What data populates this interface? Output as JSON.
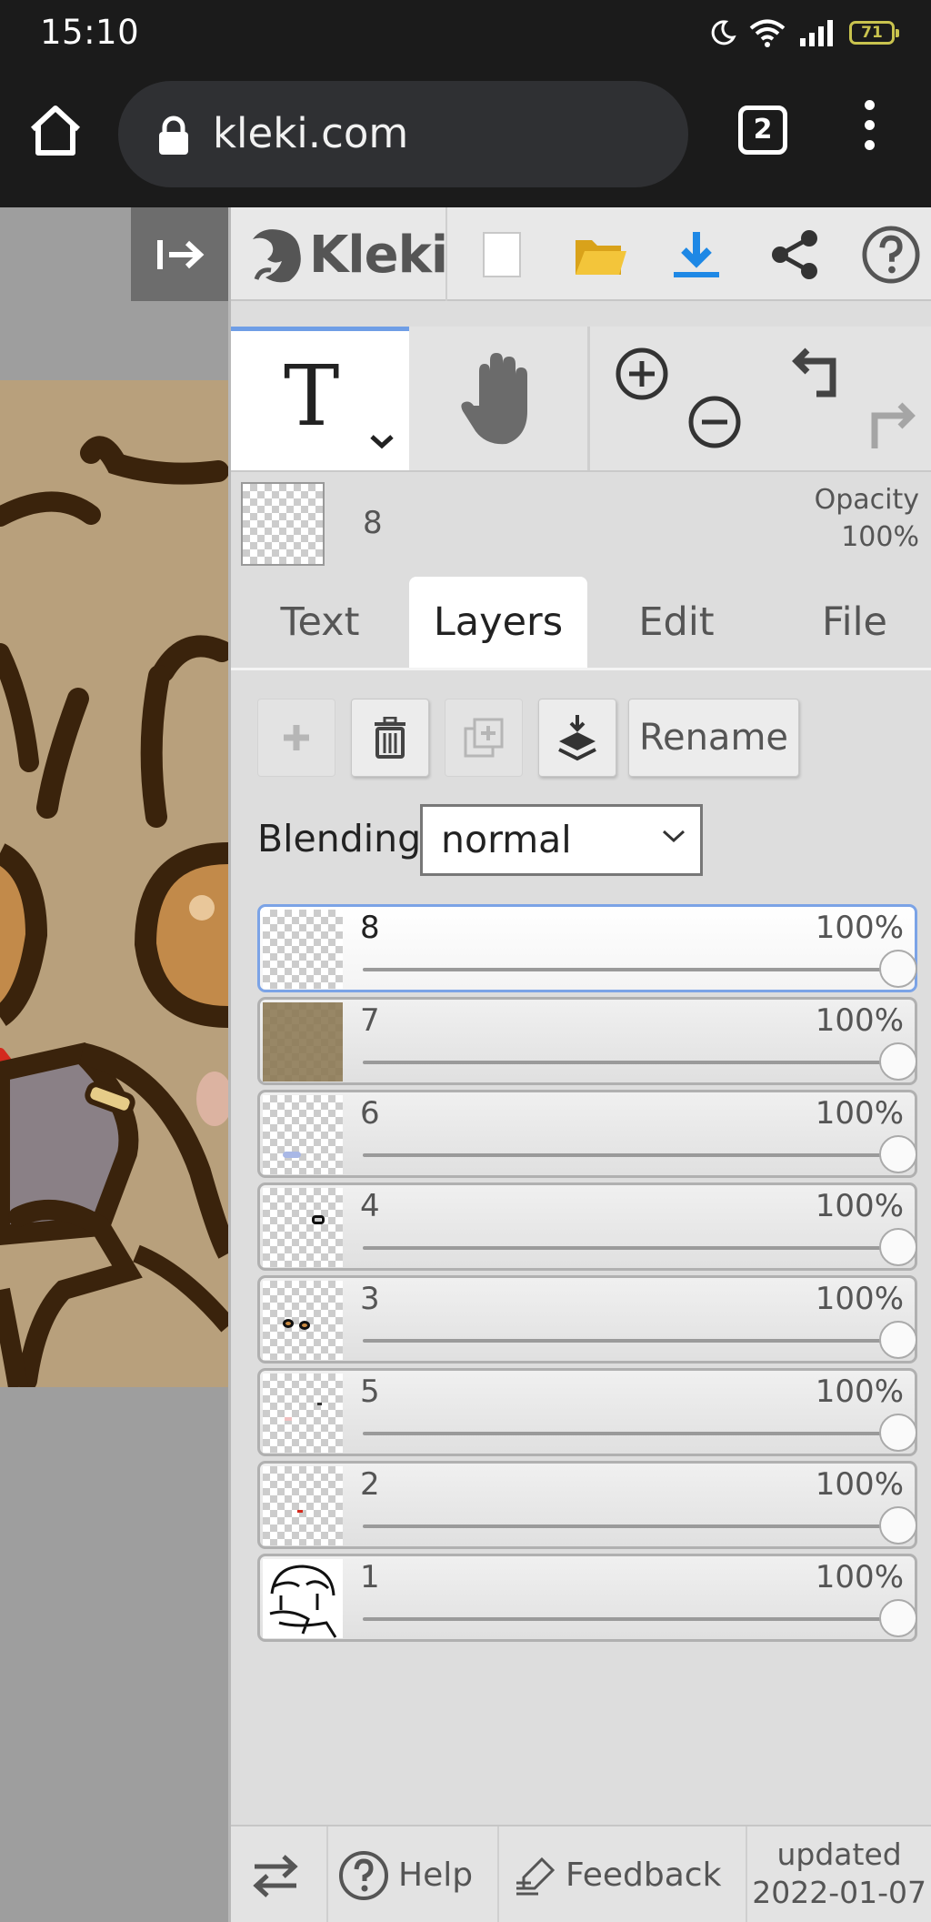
{
  "status_bar": {
    "time": "15:10",
    "battery": "71",
    "icons": [
      "moon-icon",
      "wifi-icon",
      "signal-icon",
      "battery-icon"
    ]
  },
  "browser": {
    "url": "kleki.com",
    "tab_count": "2"
  },
  "app": {
    "name": "Kleki",
    "accent_color": "#6f9ee6"
  },
  "current_layer": {
    "name": "8",
    "opacity_label": "Opacity",
    "opacity_value": "100%"
  },
  "tabs": [
    {
      "label": "Text",
      "active": false
    },
    {
      "label": "Layers",
      "active": true
    },
    {
      "label": "Edit",
      "active": false
    },
    {
      "label": "File",
      "active": false
    }
  ],
  "layer_buttons": {
    "rename_label": "Rename"
  },
  "blending": {
    "label": "Blending",
    "value": "normal"
  },
  "layers": [
    {
      "name": "8",
      "opacity": "100%",
      "opacity_value": 1.0,
      "active": true
    },
    {
      "name": "7",
      "opacity": "100%",
      "opacity_value": 1.0,
      "active": false
    },
    {
      "name": "6",
      "opacity": "100%",
      "opacity_value": 1.0,
      "active": false
    },
    {
      "name": "4",
      "opacity": "100%",
      "opacity_value": 1.0,
      "active": false
    },
    {
      "name": "3",
      "opacity": "100%",
      "opacity_value": 1.0,
      "active": false
    },
    {
      "name": "5",
      "opacity": "100%",
      "opacity_value": 1.0,
      "active": false
    },
    {
      "name": "2",
      "opacity": "100%",
      "opacity_value": 1.0,
      "active": false
    },
    {
      "name": "1",
      "opacity": "100%",
      "opacity_value": 1.0,
      "active": false
    }
  ],
  "footer": {
    "help_label": "Help",
    "feedback_label": "Feedback",
    "updated_label": "updated",
    "updated_date": "2022-01-07"
  }
}
